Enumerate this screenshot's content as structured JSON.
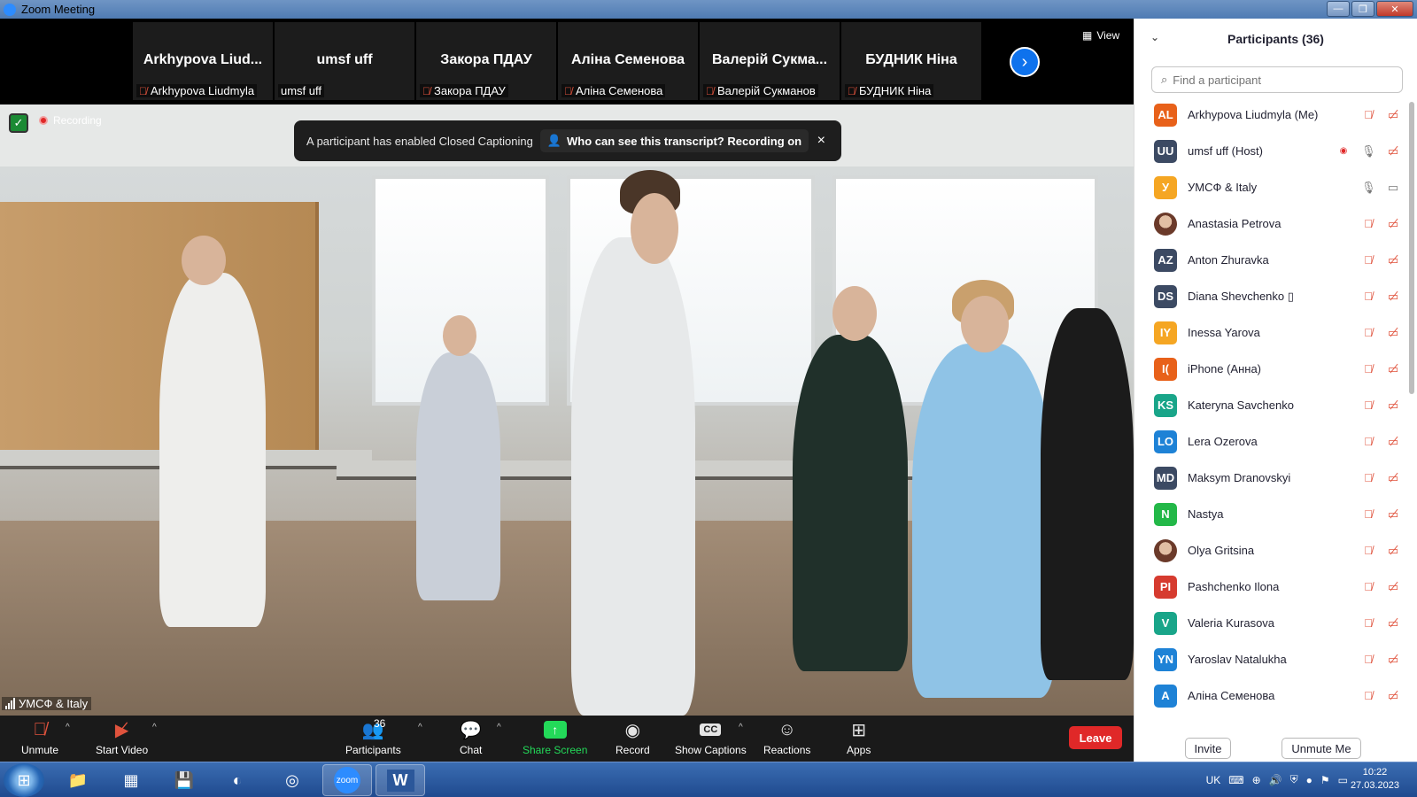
{
  "window": {
    "title": "Zoom Meeting"
  },
  "gallery": {
    "view_label": "View",
    "tiles": [
      {
        "display_name": "Arkhypova  Liud...",
        "label": "Arkhypova Liudmyla",
        "muted": true
      },
      {
        "display_name": "umsf uff",
        "label": "umsf uff",
        "muted": false
      },
      {
        "display_name": "Закора ПДАУ",
        "label": "Закора ПДАУ",
        "muted": true
      },
      {
        "display_name": "Аліна Семенова",
        "label": "Аліна Семенова",
        "muted": true
      },
      {
        "display_name": "Валерій  Сукма...",
        "label": "Валерій Сукманов",
        "muted": true
      },
      {
        "display_name": "БУДНИК Ніна",
        "label": "БУДНИК Ніна",
        "muted": true
      }
    ]
  },
  "main_video": {
    "recording_label": "Recording",
    "speaker_label": "УМСФ & Italy",
    "banner": {
      "message": "A participant has enabled Closed Captioning",
      "link": "Who can see this transcript? Recording on",
      "close": "×"
    }
  },
  "toolbar": {
    "unmute": "Unmute",
    "start_video": "Start Video",
    "participants": "Participants",
    "participants_count": "36",
    "chat": "Chat",
    "share_screen": "Share Screen",
    "record": "Record",
    "show_captions": "Show Captions",
    "reactions": "Reactions",
    "apps": "Apps",
    "leave": "Leave",
    "cc_icon": "CC"
  },
  "panel": {
    "title": "Participants (36)",
    "search_placeholder": "Find a participant",
    "invite": "Invite",
    "unmute_me": "Unmute Me",
    "participants": [
      {
        "initials": "AL",
        "name": "Arkhypova Liudmyla (Me)",
        "color": "#e8611a",
        "mic": "off",
        "video": "off"
      },
      {
        "initials": "UU",
        "name": "umsf uff (Host)",
        "color": "#3c4a63",
        "mic": "on",
        "video": "off",
        "recording": true
      },
      {
        "initials": "У",
        "name": "УМСФ & Italy",
        "color": "#f5a623",
        "mic": "on",
        "video": "on"
      },
      {
        "initials": "",
        "name": "Anastasia Petrova",
        "color": "#6b3a2a",
        "mic": "off",
        "video": "off",
        "photo": true
      },
      {
        "initials": "AZ",
        "name": "Anton Zhuravka",
        "color": "#3c4a63",
        "mic": "off",
        "video": "off"
      },
      {
        "initials": "DS",
        "name": "Diana Shevchenko ▯",
        "color": "#3c4a63",
        "mic": "off",
        "video": "off"
      },
      {
        "initials": "IY",
        "name": "Inessa Yarova",
        "color": "#f5a623",
        "mic": "off",
        "video": "off"
      },
      {
        "initials": "I(",
        "name": "iPhone (Анна)",
        "color": "#e8611a",
        "mic": "off",
        "video": "off"
      },
      {
        "initials": "KS",
        "name": "Kateryna Savchenko",
        "color": "#19a589",
        "mic": "off",
        "video": "off"
      },
      {
        "initials": "LO",
        "name": "Lera Ozerova",
        "color": "#1e82d6",
        "mic": "off",
        "video": "off"
      },
      {
        "initials": "MD",
        "name": "Maksym Dranovskyi",
        "color": "#3c4a63",
        "mic": "off",
        "video": "off"
      },
      {
        "initials": "N",
        "name": "Nastya",
        "color": "#23b848",
        "mic": "off",
        "video": "off"
      },
      {
        "initials": "",
        "name": "Olya Gritsina",
        "color": "#6b3a2a",
        "mic": "off",
        "video": "off",
        "photo": true
      },
      {
        "initials": "PI",
        "name": "Pashchenko Ilona",
        "color": "#d63b2f",
        "mic": "off",
        "video": "off"
      },
      {
        "initials": "V",
        "name": "Valeria Kurasova",
        "color": "#19a589",
        "mic": "off",
        "video": "off"
      },
      {
        "initials": "YN",
        "name": "Yaroslav Natalukha",
        "color": "#1e82d6",
        "mic": "off",
        "video": "off"
      },
      {
        "initials": "A",
        "name": "Аліна Семенова",
        "color": "#1e82d6",
        "mic": "off",
        "video": "off"
      }
    ]
  },
  "taskbar": {
    "language": "UK",
    "time": "10:22",
    "date": "27.03.2023",
    "zoom_label": "zoom",
    "word_label": "W"
  }
}
